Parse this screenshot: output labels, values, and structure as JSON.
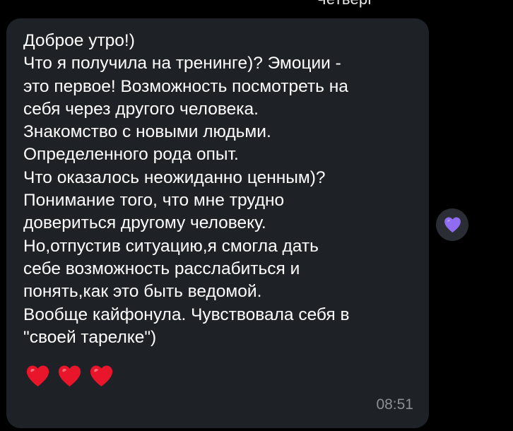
{
  "header": {
    "date_label": "Четверг"
  },
  "message": {
    "text": "Доброе утро!)\nЧто я получила на тренинге)? Эмоции -\nэто первое! Возможность посмотреть на\nсебя через другого человека.\nЗнакомство с новыми людьми.\nОпределенного рода опыт.\nЧто оказалось неожиданно ценным)?\nПонимание того, что мне трудно\nдовериться другому человеку.\nНо,отпустив ситуацию,я смогла дать\nсебе возможность расслабиться и\nпонять,как это быть ведомой.\nВообще кайфонула. Чувствовала себя в\n\"своей тарелке\")",
    "emojis": [
      "red-heart",
      "red-heart",
      "red-heart"
    ],
    "time": "08:51"
  },
  "reaction": {
    "icon": "purple-heart"
  },
  "colors": {
    "background": "#000000",
    "bubble": "#1e2126",
    "text": "#ffffff",
    "time": "#8c9096",
    "red_heart": "#e8152b",
    "purple_heart": "#8f6cf0"
  }
}
